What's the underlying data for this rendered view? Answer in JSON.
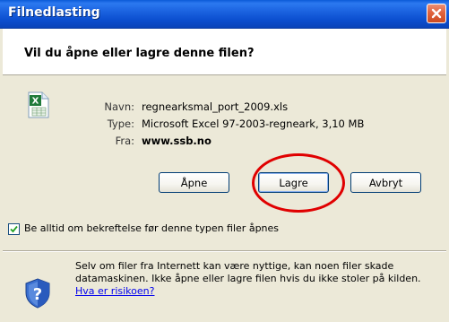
{
  "window": {
    "title": "Filnedlasting",
    "close_icon": "close-x-icon"
  },
  "dialog": {
    "question": "Vil du åpne eller lagre denne filen?",
    "file_icon": "excel-file-icon",
    "details": {
      "name_label": "Navn:",
      "name_value": "regnearksmal_port_2009.xls",
      "type_label": "Type:",
      "type_value": "Microsoft Excel 97-2003-regneark, 3,10 MB",
      "from_label": "Fra:",
      "from_value": "www.ssb.no"
    },
    "buttons": {
      "open": "Åpne",
      "save": "Lagre",
      "cancel": "Avbryt"
    },
    "checkbox": {
      "label": "Be alltid om bekreftelse før denne typen filer åpnes",
      "checked": true
    },
    "warning": {
      "icon": "security-shield-icon",
      "text": "Selv om filer fra Internett kan være nyttige, kan noen filer skade datamaskinen. Ikke åpne eller lagre filen hvis du ikke stoler på kilden. ",
      "link": "Hva er risikoen?"
    }
  },
  "annotation": {
    "highlight": "red-circle-around-save-button",
    "color": "#e00000"
  },
  "colors": {
    "titlebar": "#0a5bd8",
    "dialog_bg": "#ece9d8",
    "close_button": "#e0633e",
    "link": "#0000ee"
  }
}
